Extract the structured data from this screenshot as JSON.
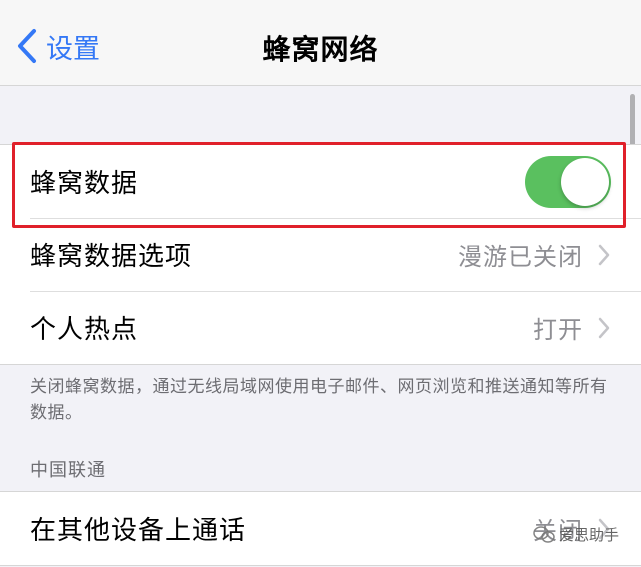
{
  "nav": {
    "back_label": "设置",
    "title": "蜂窝网络"
  },
  "cellular_group": {
    "items": [
      {
        "label": "蜂窝数据",
        "type": "toggle",
        "on": true
      },
      {
        "label": "蜂窝数据选项",
        "value": "漫游已关闭",
        "type": "disclosure"
      },
      {
        "label": "个人热点",
        "value": "打开",
        "type": "disclosure"
      }
    ]
  },
  "footnote": "关闭蜂窝数据，通过无线局域网使用电子邮件、网页浏览和推送通知等所有数据。",
  "carrier_section": {
    "header": "中国联通",
    "items": [
      {
        "label": "在其他设备上通话",
        "value": "关闭",
        "type": "disclosure"
      }
    ]
  },
  "watermark": "爱思助手",
  "icons": {
    "back": "chevron-left-icon",
    "disclosure": "chevron-right-icon"
  },
  "colors": {
    "accent": "#3478f6",
    "toggle_on": "#5ac05f",
    "highlight": "#e0202a"
  }
}
